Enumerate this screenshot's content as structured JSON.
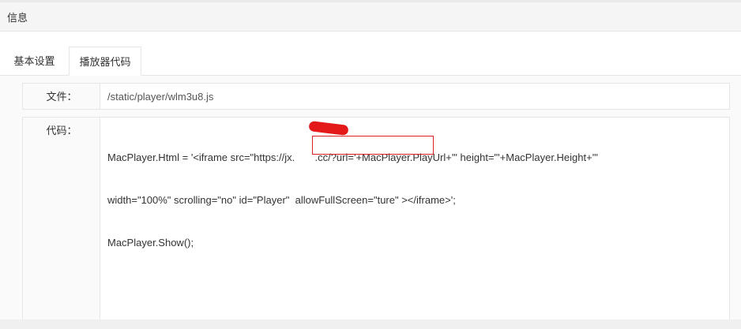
{
  "panel": {
    "title": "信息"
  },
  "tabs": [
    {
      "label": "基本设置",
      "active": false
    },
    {
      "label": "播放器代码",
      "active": true
    }
  ],
  "form": {
    "file_label": "文件：",
    "file_value": "/static/player/wlm3u8.js",
    "code_label": "代码：",
    "code_lines": [
      "MacPlayer.Html = '<iframe src=\"https://jx.       .cc/?url='+MacPlayer.PlayUrl+'\" height=\"'+MacPlayer.Height+'\"",
      "width=\"100%\" scrolling=\"no\" id=\"Player\"  allowFullScreen=\"ture\" ></iframe>';",
      "MacPlayer.Show();"
    ]
  },
  "colors": {
    "highlight_border": "#e02020",
    "redaction": "#e41a1a"
  }
}
